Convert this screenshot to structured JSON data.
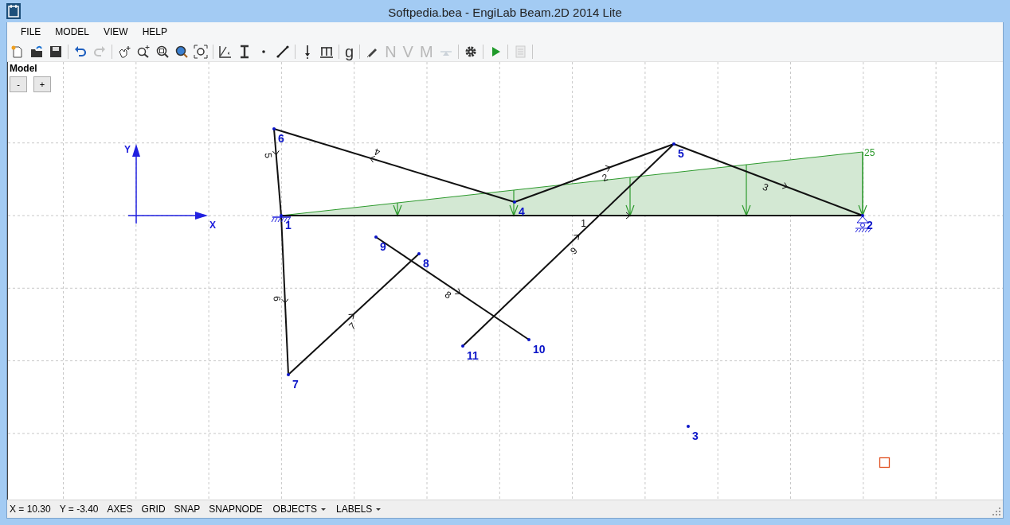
{
  "window": {
    "title": "Softpedia.bea - EngiLab Beam.2D 2014 Lite"
  },
  "menu": [
    "FILE",
    "MODEL",
    "VIEW",
    "HELP"
  ],
  "toolbar": [
    {
      "kind": "icon",
      "disabled": false
    },
    {
      "kind": "icon",
      "disabled": false
    },
    {
      "kind": "icon",
      "disabled": false
    },
    {
      "kind": "separator"
    },
    {
      "kind": "icon",
      "disabled": false
    },
    {
      "kind": "icon",
      "disabled": true
    },
    {
      "kind": "separator"
    },
    {
      "kind": "icon",
      "disabled": false
    },
    {
      "kind": "icon",
      "disabled": false
    },
    {
      "kind": "icon",
      "disabled": false
    },
    {
      "kind": "icon",
      "disabled": false
    },
    {
      "kind": "icon",
      "disabled": false
    },
    {
      "kind": "separator"
    },
    {
      "kind": "icon",
      "disabled": false
    },
    {
      "kind": "icon",
      "disabled": false
    },
    {
      "kind": "icon",
      "disabled": false
    },
    {
      "kind": "icon",
      "disabled": false
    },
    {
      "kind": "separator"
    },
    {
      "kind": "icon",
      "disabled": false
    },
    {
      "kind": "icon",
      "disabled": false
    },
    {
      "kind": "separator"
    },
    {
      "kind": "text",
      "text": "g",
      "disabled": false
    },
    {
      "kind": "separator"
    },
    {
      "kind": "icon",
      "disabled": false
    },
    {
      "kind": "text",
      "text": "N",
      "disabled": true
    },
    {
      "kind": "text",
      "text": "V",
      "disabled": true
    },
    {
      "kind": "text",
      "text": "M",
      "disabled": true
    },
    {
      "kind": "icon",
      "disabled": true
    },
    {
      "kind": "separator"
    },
    {
      "kind": "icon",
      "disabled": false
    },
    {
      "kind": "separator"
    },
    {
      "kind": "icon",
      "disabled": false
    },
    {
      "kind": "separator"
    },
    {
      "kind": "icon",
      "disabled": true
    },
    {
      "kind": "separator"
    }
  ],
  "model_panel": {
    "title": "Model",
    "buttons": [
      "-",
      "+"
    ]
  },
  "axes": {
    "x_label": "X",
    "y_label": "Y"
  },
  "nodes": [
    {
      "label": "1",
      "kind": "fixed"
    },
    {
      "label": "2",
      "kind": "roller"
    },
    {
      "label": "3",
      "kind": "free"
    },
    {
      "label": "4",
      "kind": "free"
    },
    {
      "label": "5",
      "kind": "free"
    },
    {
      "label": "6",
      "kind": "free"
    },
    {
      "label": "7",
      "kind": "free"
    },
    {
      "label": "8",
      "kind": "free"
    },
    {
      "label": "9",
      "kind": "free"
    },
    {
      "label": "10",
      "kind": "free"
    },
    {
      "label": "11",
      "kind": "free"
    }
  ],
  "elements": [
    {
      "label": "1"
    },
    {
      "label": "2"
    },
    {
      "label": "3"
    },
    {
      "label": "4"
    },
    {
      "label": "5"
    },
    {
      "label": "6"
    },
    {
      "label": "7"
    },
    {
      "label": "8"
    },
    {
      "label": "9"
    }
  ],
  "load": {
    "label": "25"
  },
  "status_bar": {
    "coordinates": [
      "X = 10.30",
      "Y = -3.40"
    ],
    "toggles": [
      "AXES",
      "GRID",
      "SNAP",
      "SNAPNODE"
    ],
    "dropdowns": [
      "OBJECTS",
      "LABELS"
    ]
  }
}
